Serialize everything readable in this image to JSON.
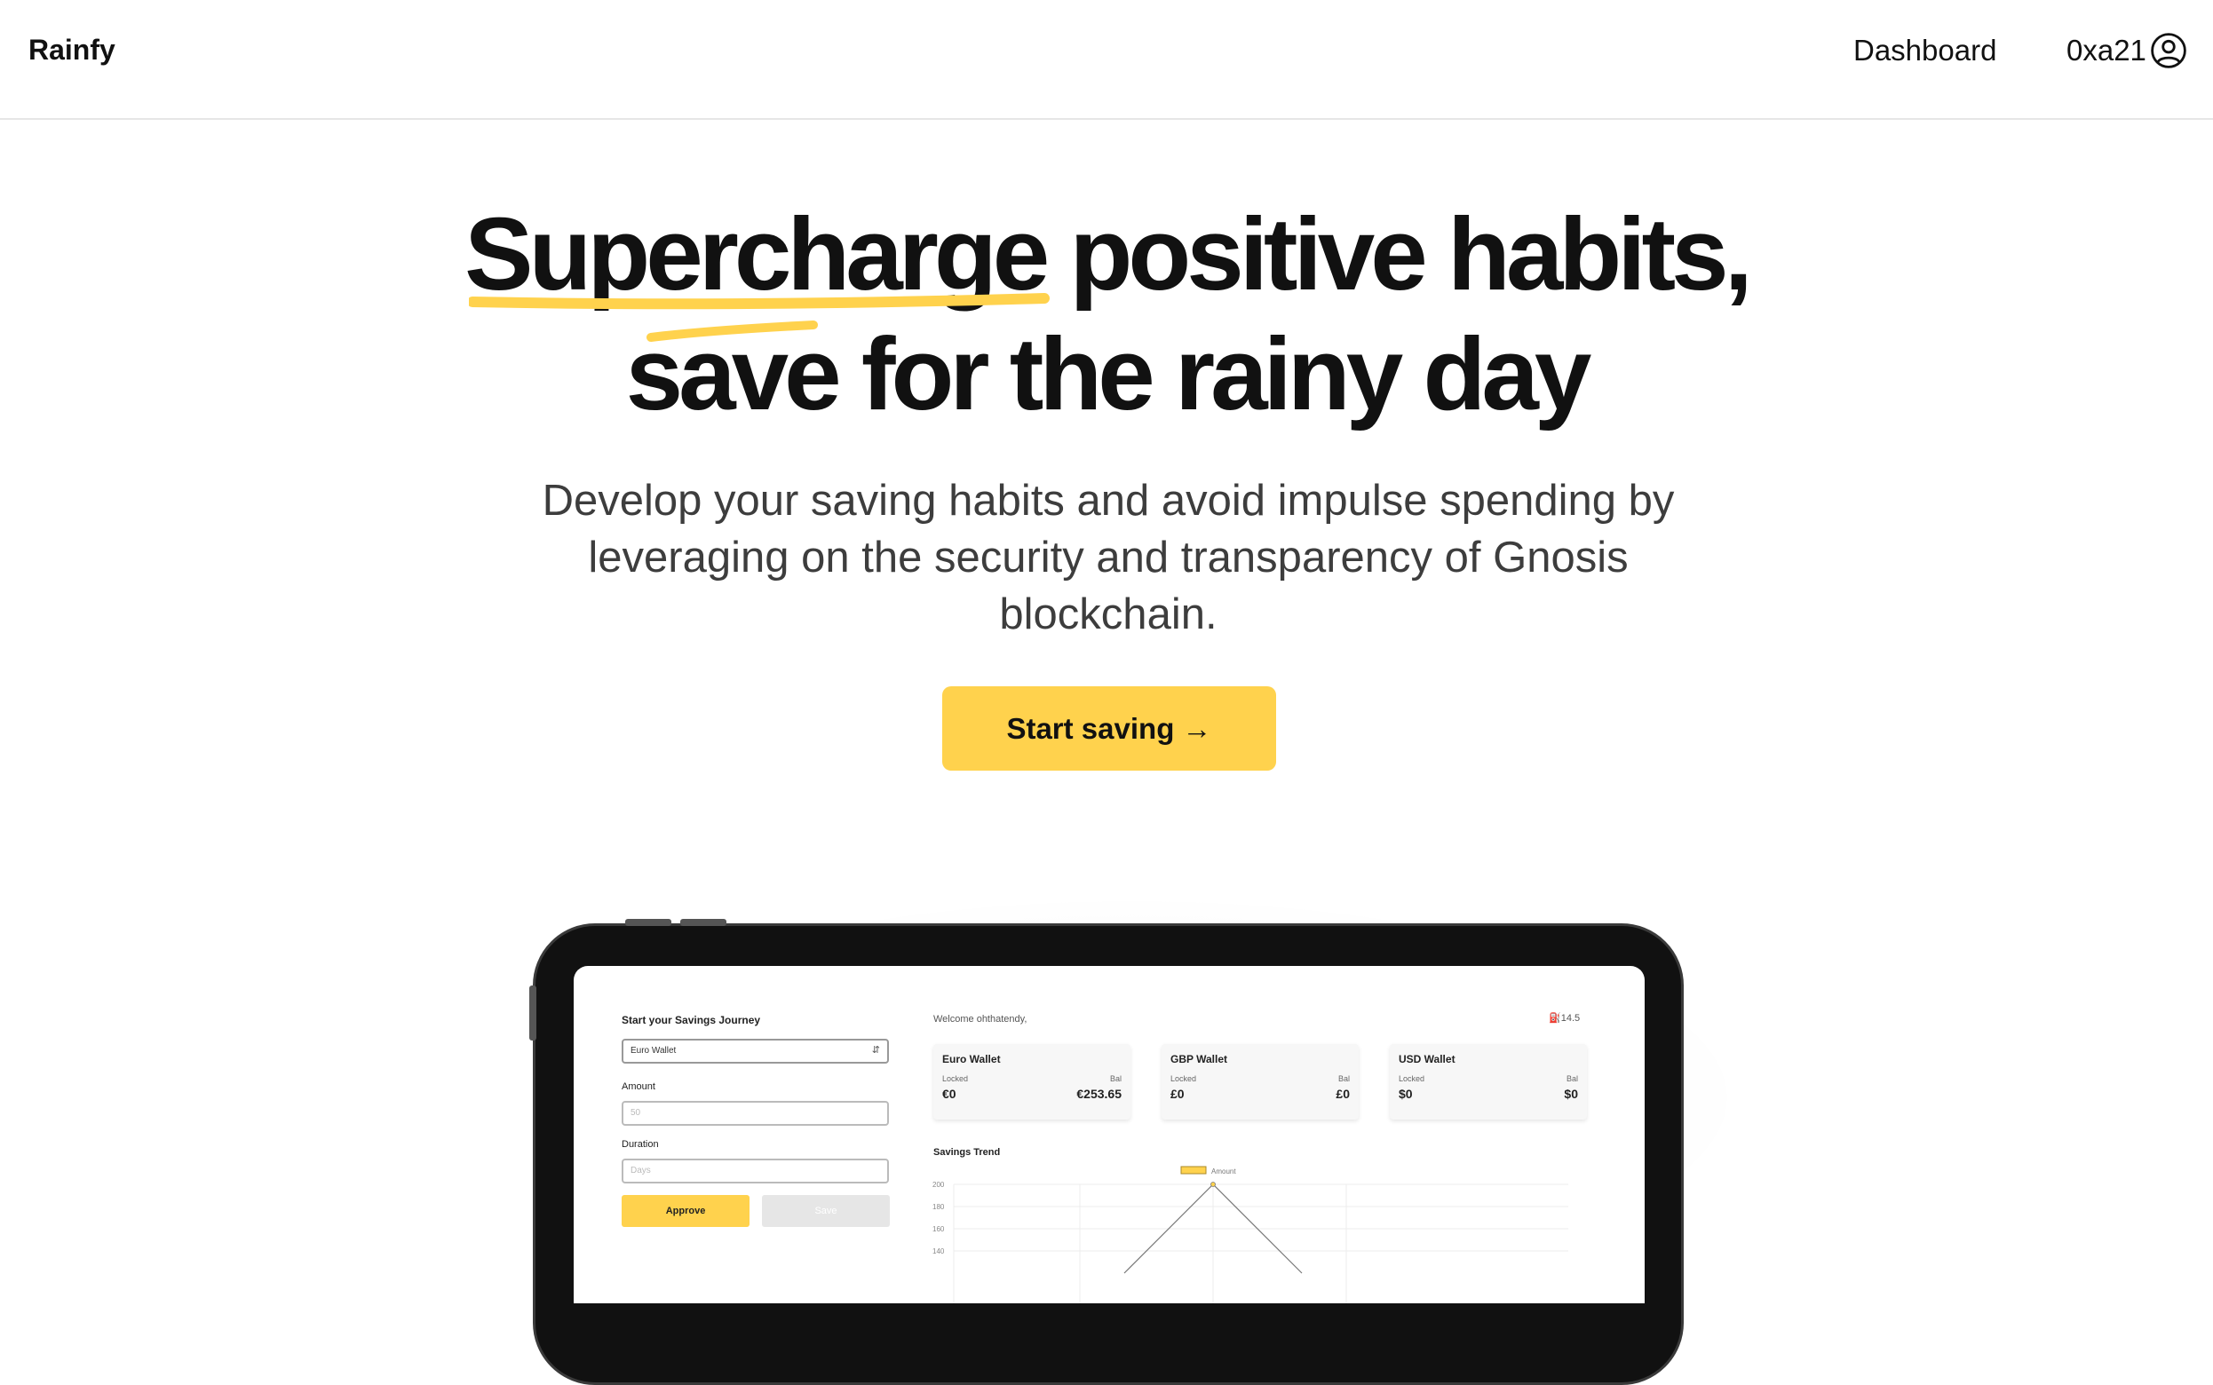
{
  "nav": {
    "brand": "Rainfy",
    "dashboard_link": "Dashboard",
    "account_label": "0xa21",
    "account_icon": "user-circle-icon"
  },
  "hero": {
    "title_line1": "Supercharge positive habits,",
    "title_line2": "save for the rainy day",
    "subtitle": "Develop your saving habits and avoid impulse spending by leveraging on the security and transparency of Gnosis blockchain.",
    "cta_label": "Start saving →"
  },
  "colors": {
    "accent": "#ffd24d",
    "text": "#111111",
    "subtitle_text": "#3d3d3d",
    "nav_border": "#e6e6e6"
  },
  "preview": {
    "form": {
      "heading": "Start your Savings Journey",
      "wallet_select_value": "Euro Wallet",
      "amount_label": "Amount",
      "amount_placeholder": "50",
      "duration_label": "Duration",
      "duration_placeholder": "Days",
      "approve_label": "Approve",
      "save_label": "Save"
    },
    "welcome": "Welcome ohthatendy,",
    "gas": "14.5",
    "wallets": [
      {
        "name": "Euro Wallet",
        "locked_label": "Locked",
        "bal_label": "Bal",
        "locked": "€0",
        "balance": "€253.65"
      },
      {
        "name": "GBP Wallet",
        "locked_label": "Locked",
        "bal_label": "Bal",
        "locked": "£0",
        "balance": "£0"
      },
      {
        "name": "USD Wallet",
        "locked_label": "Locked",
        "bal_label": "Bal",
        "locked": "$0",
        "balance": "$0"
      }
    ],
    "trend": {
      "title": "Savings Trend",
      "legend": "Amount",
      "y_ticks": [
        "200",
        "180",
        "160",
        "140"
      ]
    }
  },
  "chart_data": {
    "type": "line",
    "title": "Savings Trend",
    "series": [
      {
        "name": "Amount",
        "x": [
          0,
          1,
          2
        ],
        "values": [
          120,
          200,
          120
        ]
      }
    ],
    "yticks": [
      200,
      180,
      160,
      140
    ],
    "ylim": [
      140,
      200
    ],
    "grid": true,
    "legend": "top-center"
  }
}
